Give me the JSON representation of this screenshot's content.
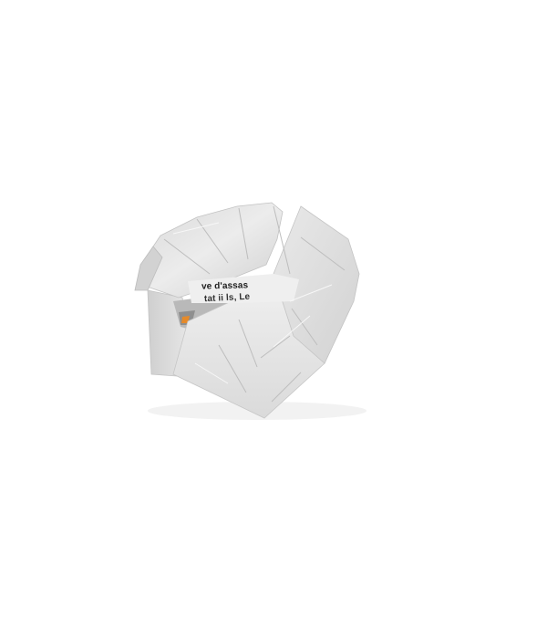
{
  "image": {
    "subject": "crumpled-paper-ball",
    "background_color": "#ffffff",
    "paper_color": "#e4e4e4",
    "ink_color": "#1e1e1e",
    "accent_color": "#e58a2a"
  },
  "printed_text": {
    "line_1": "ve d'assas",
    "line_2": "tat ii ls, Le"
  }
}
